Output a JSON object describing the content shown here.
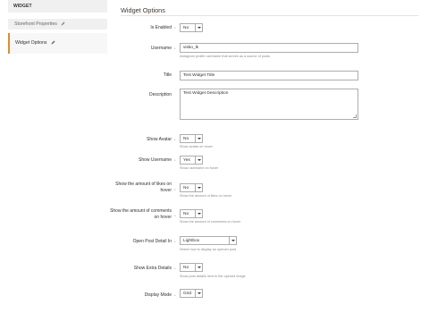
{
  "sidebar": {
    "heading": "WIDGET",
    "items": [
      {
        "label": "Storefront Properties",
        "icon": "pencil-icon"
      },
      {
        "label": "Widget Options",
        "icon": "pencil-icon",
        "active": true
      }
    ]
  },
  "main": {
    "title": "Widget Options",
    "scope_marker": "*",
    "fields": {
      "is_enabled": {
        "label": "Is Enabled",
        "value": "No"
      },
      "username": {
        "label": "Username",
        "value": "visko_lk",
        "note": "Instagram profile username that serves as a source of posts"
      },
      "title": {
        "label": "Title",
        "value": "Test Widget Title"
      },
      "description": {
        "label": "Description",
        "value": "Test Widget Description"
      },
      "show_avatar": {
        "label": "Show Avatar",
        "value": "No",
        "note": "Show avatar on hover"
      },
      "show_username": {
        "label": "Show Username",
        "value": "Yes",
        "note": "Show username on hover"
      },
      "show_likes": {
        "label": "Show the amount of likes on hover",
        "value": "No",
        "note": "Show the amount of likes on hover"
      },
      "show_comments": {
        "label": "Show the amount of comments on hover",
        "value": "No",
        "note": "Show the amount of comments on hover"
      },
      "open_post_detail": {
        "label": "Open Post Detail In",
        "value": "Lightbox",
        "note": "Select how to display an opened post"
      },
      "show_extra_details": {
        "label": "Show Extra Details",
        "value": "No",
        "note": "Show post details next to the opened image"
      },
      "display_mode": {
        "label": "Display Mode",
        "value": "Grid"
      }
    }
  },
  "colors": {
    "active_border": "#e08b2f",
    "sidebar_bg": "#f0f0f0",
    "field_border": "#adadad"
  }
}
